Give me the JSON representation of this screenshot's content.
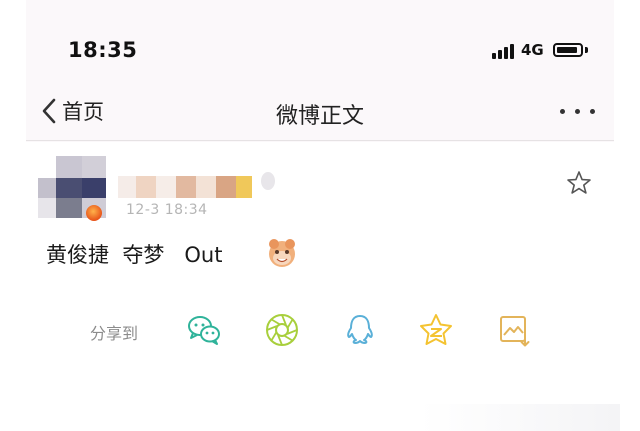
{
  "status_bar": {
    "time": "18:35",
    "network": "4G"
  },
  "nav": {
    "back_label": "首页",
    "title": "微博正文"
  },
  "post": {
    "timestamp": "12-3 18:34",
    "text": "黄俊捷  夺梦   Out",
    "emoji_icon": "happy-face-emoji-icon"
  },
  "share": {
    "label": "分享到",
    "targets": [
      {
        "name": "wechat",
        "color": "#2fb39a"
      },
      {
        "name": "moments",
        "color": "#a8cf3c"
      },
      {
        "name": "qq",
        "color": "#5ab0d8"
      },
      {
        "name": "qzone",
        "color": "#f4c331"
      },
      {
        "name": "save-image",
        "color": "#e3b45a"
      }
    ]
  },
  "colors": {
    "header_bg": "#fbf8fa",
    "text": "#1a1a1a",
    "muted": "#8c8c8c"
  }
}
